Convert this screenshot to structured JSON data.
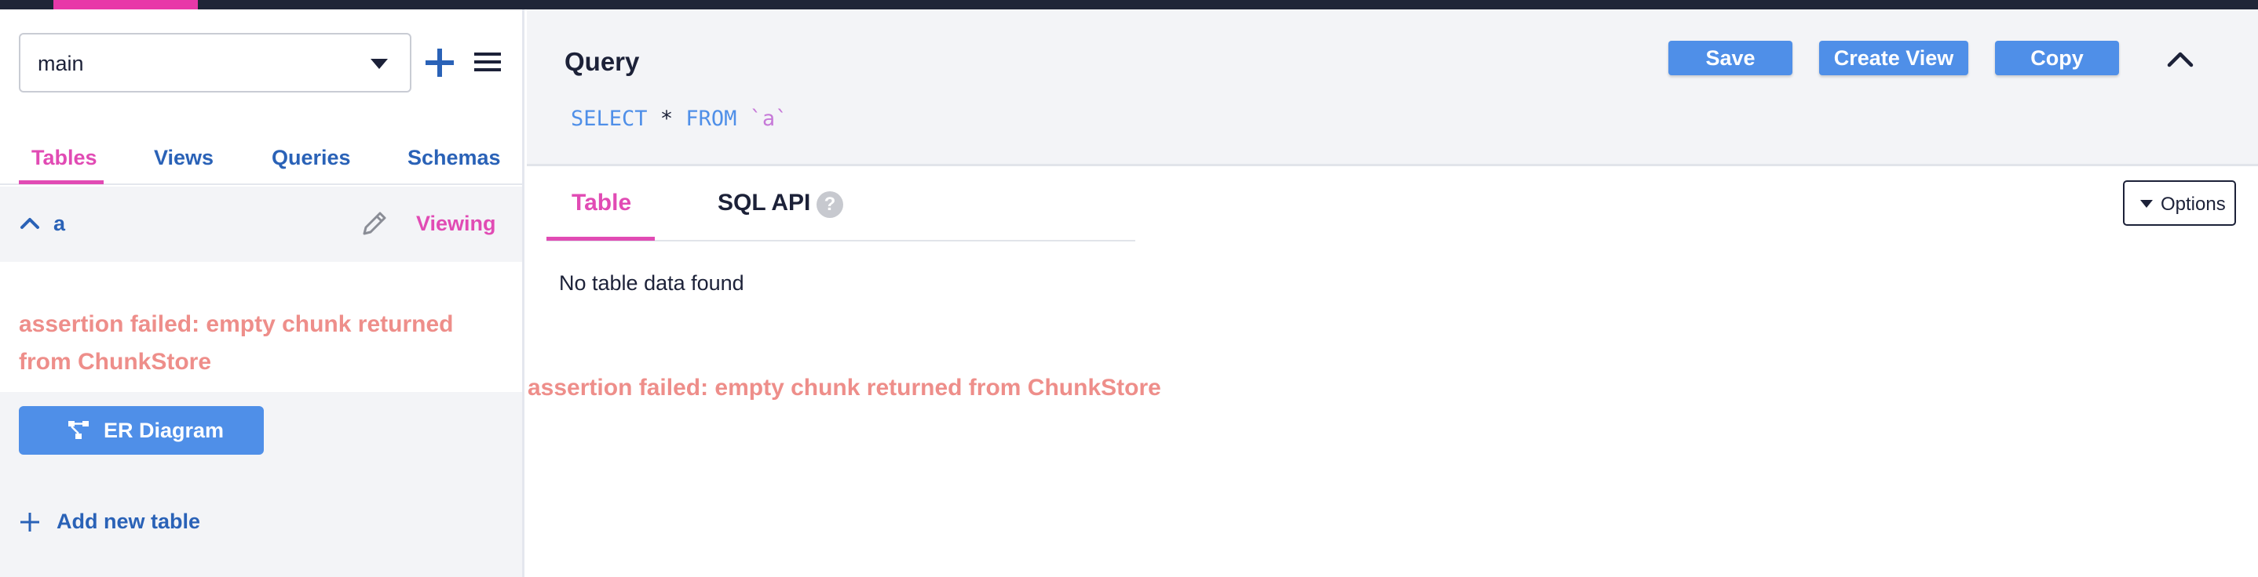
{
  "colors": {
    "accent_pink": "#e14bb4",
    "link_blue": "#2a62b7",
    "button_blue": "#4f8fe8",
    "error_text": "#ee8e8a",
    "dark": "#1c2138"
  },
  "sidebar": {
    "database_select": {
      "value": "main"
    },
    "add_icon": "plus-icon",
    "menu_icon": "hamburger-menu-icon",
    "tabs": [
      {
        "label": "Tables",
        "active": true
      },
      {
        "label": "Views",
        "active": false
      },
      {
        "label": "Queries",
        "active": false
      },
      {
        "label": "Schemas",
        "active": false
      }
    ],
    "table_item": {
      "name": "a",
      "status": "Viewing",
      "expanded": true
    },
    "error_message": "assertion failed: empty chunk returned from ChunkStore",
    "er_diagram_label": "ER Diagram",
    "add_table_label": "Add new table"
  },
  "query": {
    "title": "Query",
    "sql": {
      "select": "SELECT",
      "star": "*",
      "from": "FROM",
      "table": "`a`"
    },
    "save_label": "Save",
    "create_view_label": "Create View",
    "copy_label": "Copy"
  },
  "results": {
    "tabs": [
      {
        "label": "Table",
        "active": true
      },
      {
        "label": "SQL API",
        "active": false
      }
    ],
    "help_glyph": "?",
    "options_label": "Options",
    "empty_message": "No table data found",
    "error_message": "assertion failed: empty chunk returned from ChunkStore"
  }
}
